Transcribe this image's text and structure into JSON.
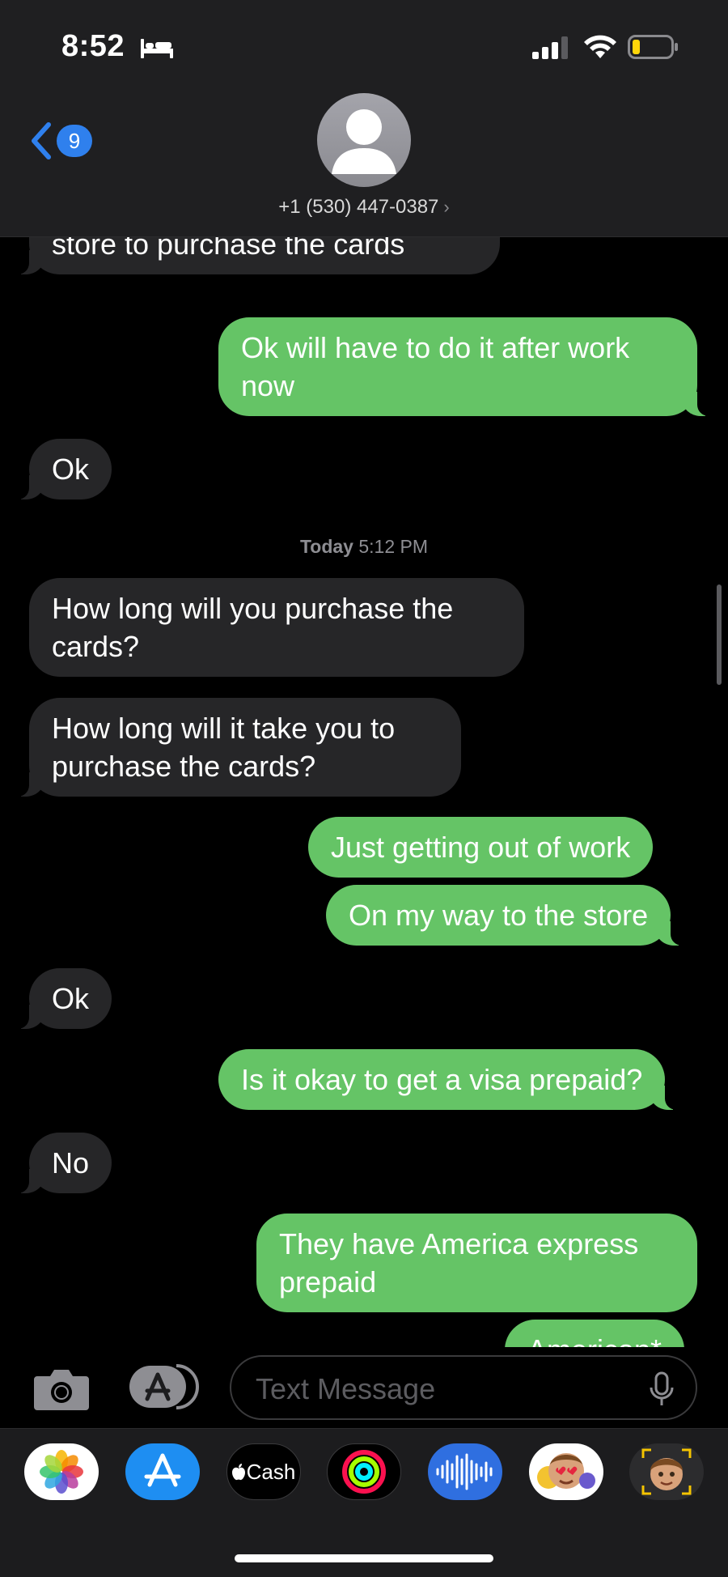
{
  "status_bar": {
    "time": "8:52"
  },
  "header": {
    "back_badge": "9",
    "contact": "+1 (530) 447-0387",
    "contact_chevron": "›"
  },
  "messages": [
    {
      "text": "You will have to go to another store to purchase the cards"
    },
    {
      "text": "Ok will have to do it after work now"
    },
    {
      "text": "Ok"
    },
    {
      "text": "How long will you purchase the cards?"
    },
    {
      "text": "How long will it take you to purchase the cards?"
    },
    {
      "text": "Just getting out of work"
    },
    {
      "text": "On my way to the store"
    },
    {
      "text": "Ok"
    },
    {
      "text": "Is it okay to get a visa prepaid?"
    },
    {
      "text": "No"
    },
    {
      "text": "They have America express prepaid"
    },
    {
      "text": "American*"
    }
  ],
  "timestamp": {
    "day": "Today",
    "time": "5:12 PM"
  },
  "input": {
    "placeholder": "Text Message"
  },
  "app_drawer": {
    "items": [
      {
        "name": "Photos",
        "icon": "photos-icon"
      },
      {
        "name": "App Store",
        "icon": "app-store-icon"
      },
      {
        "name": "Cash",
        "icon": "apple-cash-icon",
        "label": "Cash"
      },
      {
        "name": "Activity",
        "icon": "activity-rings-icon"
      },
      {
        "name": "Audio",
        "icon": "audio-message-icon"
      },
      {
        "name": "Memoji Stickers",
        "icon": "memoji-stickers-icon"
      },
      {
        "name": "Memoji",
        "icon": "memoji-icon"
      }
    ]
  },
  "colors": {
    "outgoing": "#65c466",
    "incoming": "#262628",
    "accent": "#2f80ed",
    "background": "#000000"
  }
}
